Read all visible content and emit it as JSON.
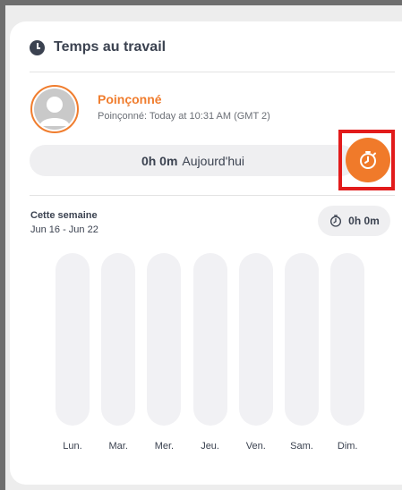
{
  "widget": {
    "title": "Temps au travail"
  },
  "status": {
    "name": "Poinçonné",
    "detail": "Poinçonné: Today at 10:31 AM (GMT 2)"
  },
  "today": {
    "duration": "0h 0m",
    "label": "Aujourd'hui"
  },
  "week": {
    "label": "Cette semaine",
    "range": "Jun 16 - Jun 22",
    "total": "0h 0m"
  },
  "days": [
    "Lun.",
    "Mar.",
    "Mer.",
    "Jeu.",
    "Ven.",
    "Sam.",
    "Dim."
  ],
  "hours_per_day": [
    0,
    0,
    0,
    0,
    0,
    0,
    0
  ],
  "colors": {
    "accent": "#f07a2a",
    "highlight": "#e21b1b",
    "text": "#3b4250",
    "bar": "#f1f1f4"
  },
  "icons": {
    "header": "clock-icon",
    "clock_in": "stopwatch-icon",
    "week_total": "stopwatch-icon",
    "avatar": "user-avatar-icon"
  }
}
